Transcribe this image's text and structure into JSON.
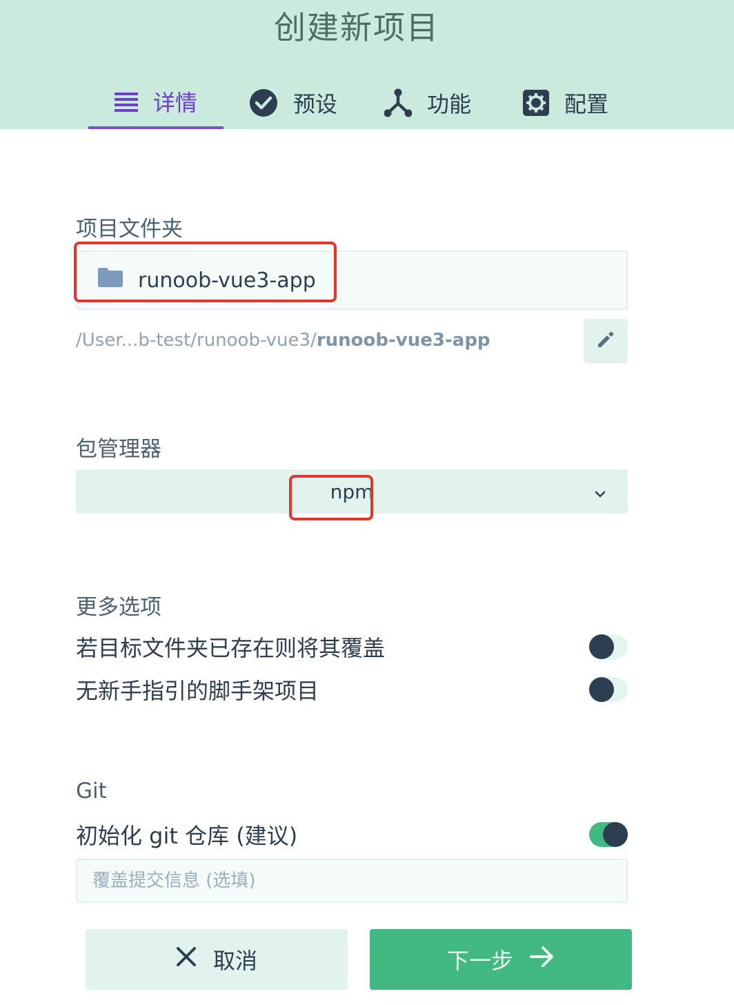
{
  "header": {
    "title": "创建新项目",
    "tabs": [
      {
        "label": "详情",
        "icon": "list-icon",
        "active": true
      },
      {
        "label": "预设",
        "icon": "check-circle-icon",
        "active": false
      },
      {
        "label": "功能",
        "icon": "fork-icon",
        "active": false
      },
      {
        "label": "配置",
        "icon": "gear-icon",
        "active": false
      }
    ]
  },
  "folder": {
    "label": "项目文件夹",
    "value": "runoob-vue3-app",
    "icon": "folder-icon",
    "path_prefix": "/User...b-test/runoob-vue3/",
    "path_name": "runoob-vue3-app",
    "edit_icon": "pencil-icon"
  },
  "package_manager": {
    "label": "包管理器",
    "selected": "npm",
    "icon": "chevron-down-icon"
  },
  "more_options": {
    "label": "更多选项",
    "items": [
      {
        "label": "若目标文件夹已存在则将其覆盖",
        "enabled": false
      },
      {
        "label": "无新手指引的脚手架项目",
        "enabled": false
      }
    ]
  },
  "git": {
    "label": "Git",
    "init_label": "初始化 git 仓库 (建议)",
    "init_enabled": true,
    "commit_placeholder": "覆盖提交信息 (选填)"
  },
  "footer": {
    "cancel_label": "取消",
    "cancel_icon": "close-icon",
    "next_label": "下一步",
    "next_icon": "arrow-right-icon"
  },
  "colors": {
    "header_bg": "#c9eadd",
    "active_tab": "#6d3fc9",
    "primary": "#42b983",
    "dark": "#2c3e50",
    "highlight": "#e8322c"
  }
}
